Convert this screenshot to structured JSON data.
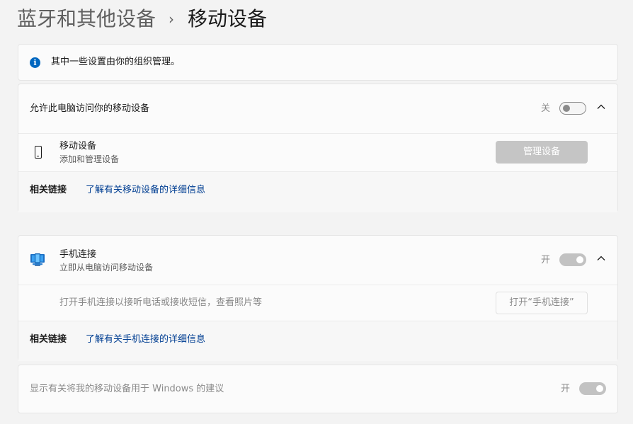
{
  "breadcrumb": {
    "parent": "蓝牙和其他设备",
    "separator": "›",
    "current": "移动设备"
  },
  "org_notice": {
    "icon": "info-icon",
    "text": "其中一些设置由你的组织管理。"
  },
  "mobile_card": {
    "header": {
      "title": "允许此电脑访问你的移动设备",
      "toggle_state_label": "关",
      "toggle_on": false,
      "expanded": true,
      "chevron": "chevron-up-icon"
    },
    "device_row": {
      "icon": "phone-icon",
      "title": "移动设备",
      "subtitle": "添加和管理设备",
      "button_label": "管理设备"
    },
    "related": {
      "label": "相关链接",
      "link": "了解有关移动设备的详细信息"
    }
  },
  "phone_link_card": {
    "header": {
      "icon": "phone-link-icon",
      "title": "手机连接",
      "subtitle": "立即从电脑访问移动设备",
      "toggle_state_label": "开",
      "toggle_on": true,
      "expanded": true,
      "chevron": "chevron-up-icon"
    },
    "detail_row": {
      "text": "打开手机连接以接听电话或接收短信，查看照片等",
      "button_label": "打开“手机连接”"
    },
    "related": {
      "label": "相关链接",
      "link": "了解有关手机连接的详细信息"
    }
  },
  "suggestions_card": {
    "text": "显示有关将我的移动设备用于 Windows 的建议",
    "toggle_state_label": "开",
    "toggle_on": true
  },
  "colors": {
    "accent": "#0067c0",
    "link": "#003e92",
    "background": "#f3f3f3"
  }
}
